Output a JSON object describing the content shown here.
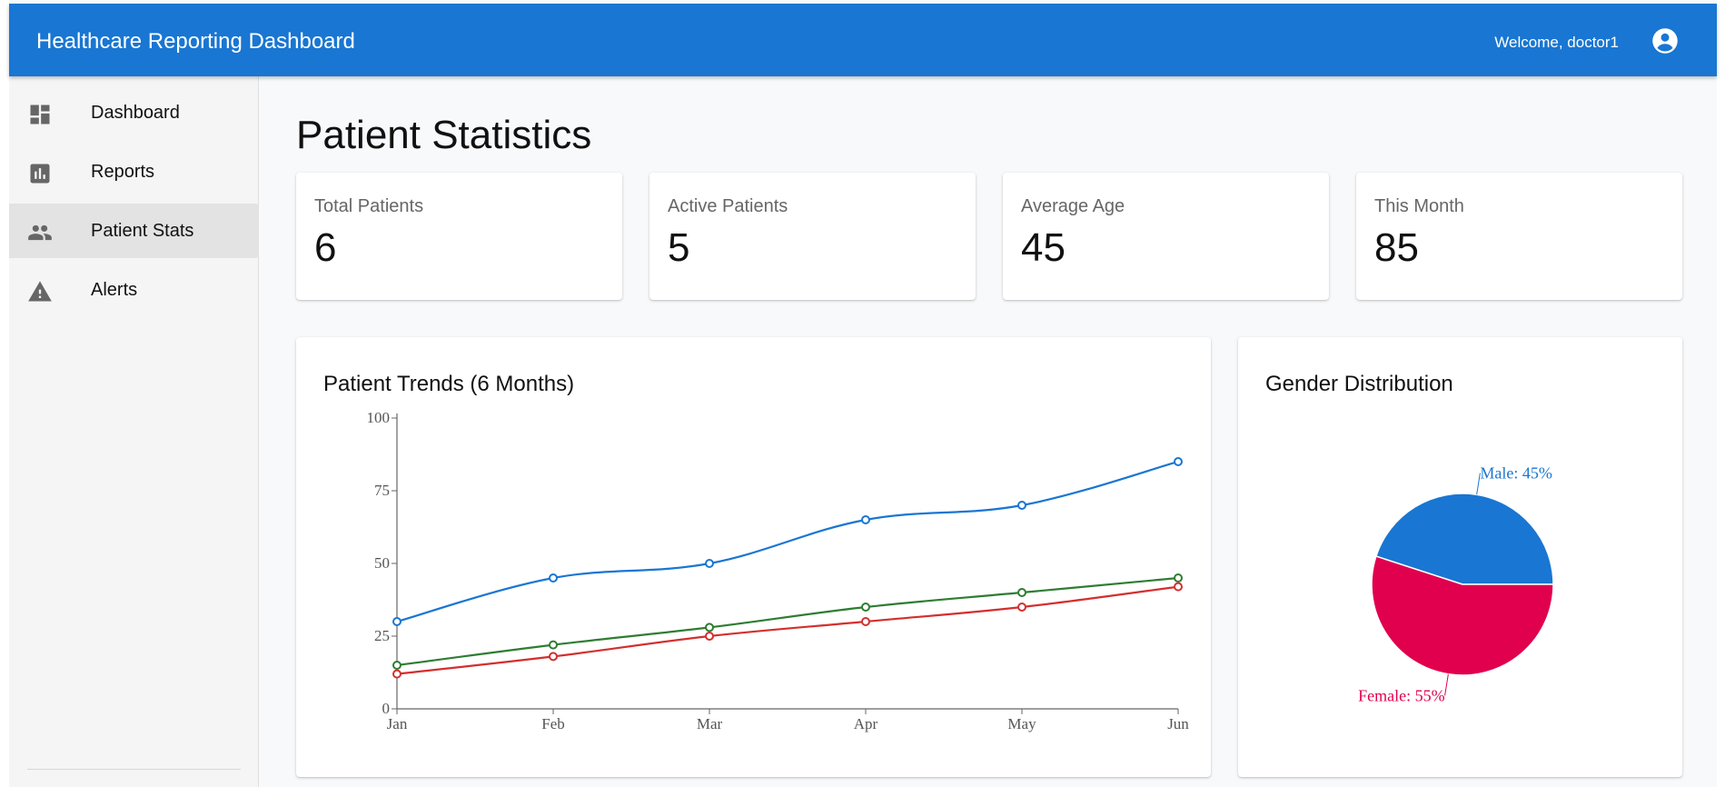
{
  "header": {
    "title": "Healthcare Reporting Dashboard",
    "welcome_text": "Welcome, doctor1",
    "account_icon": "account-circle-icon"
  },
  "sidebar": {
    "items": [
      {
        "label": "Dashboard",
        "icon": "dashboard-icon",
        "active": false
      },
      {
        "label": "Reports",
        "icon": "bar-chart-icon",
        "active": false
      },
      {
        "label": "Patient Stats",
        "icon": "people-icon",
        "active": true
      },
      {
        "label": "Alerts",
        "icon": "warning-icon",
        "active": false
      }
    ]
  },
  "main": {
    "title": "Patient Statistics",
    "stats": [
      {
        "label": "Total Patients",
        "value": "6"
      },
      {
        "label": "Active Patients",
        "value": "5"
      },
      {
        "label": "Average Age",
        "value": "45"
      },
      {
        "label": "This Month",
        "value": "85"
      }
    ],
    "trend_card_title": "Patient Trends (6 Months)",
    "gender_card_title": "Gender Distribution"
  },
  "colors": {
    "primary": "#1976d2",
    "series_blue": "#1976d2",
    "series_green": "#2e7d32",
    "series_red": "#d32f2f",
    "female": "#e0004d"
  },
  "chart_data": [
    {
      "type": "line",
      "title": "Patient Trends (6 Months)",
      "categories": [
        "Jan",
        "Feb",
        "Mar",
        "Apr",
        "May",
        "Jun"
      ],
      "ylim": [
        0,
        100
      ],
      "yticks": [
        0,
        25,
        50,
        75,
        100
      ],
      "series": [
        {
          "values": [
            30,
            45,
            50,
            65,
            70,
            85
          ],
          "color": "#1976d2"
        },
        {
          "values": [
            15,
            22,
            28,
            35,
            40,
            45
          ],
          "color": "#2e7d32"
        },
        {
          "values": [
            12,
            18,
            25,
            30,
            35,
            42
          ],
          "color": "#d32f2f"
        }
      ],
      "grid": false
    },
    {
      "type": "pie",
      "title": "Gender Distribution",
      "slices": [
        {
          "label": "Male: 45%",
          "value": 45,
          "color": "#1976d2"
        },
        {
          "label": "Female: 55%",
          "value": 55,
          "color": "#e0004d"
        }
      ]
    }
  ]
}
